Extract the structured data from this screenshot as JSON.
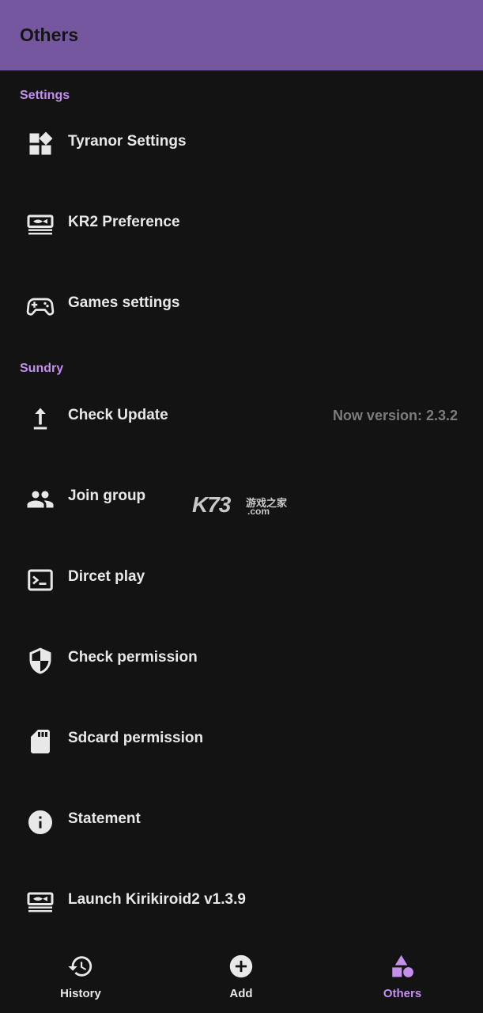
{
  "appbar": {
    "title": "Others"
  },
  "sections": {
    "settings_header": "Settings",
    "sundry_header": "Sundry"
  },
  "items": {
    "tyranor": {
      "label": "Tyranor Settings",
      "icon": "widgets-icon"
    },
    "kr2": {
      "label": "KR2 Preference",
      "icon": "kr2-logo-icon"
    },
    "games": {
      "label": "Games settings",
      "icon": "gamepad-icon"
    },
    "update": {
      "label": "Check Update",
      "trailing": "Now version: 2.3.2",
      "icon": "upload-arrow-icon"
    },
    "join": {
      "label": "Join group",
      "icon": "people-icon"
    },
    "direct": {
      "label": "Dircet play",
      "icon": "terminal-icon"
    },
    "permission": {
      "label": "Check permission",
      "icon": "shield-icon"
    },
    "sdcard": {
      "label": "Sdcard permission",
      "icon": "sdcard-icon"
    },
    "statement": {
      "label": "Statement",
      "icon": "info-icon"
    },
    "launch": {
      "label": "Launch Kirikiroid2 v1.3.9",
      "icon": "kr2-logo-icon"
    }
  },
  "watermark": {
    "brand": "K73",
    "chinese": "游戏之家",
    "domain": ".com"
  },
  "bottom_nav": {
    "history": "History",
    "add": "Add",
    "others": "Others"
  },
  "colors": {
    "appbar": "#7557a0",
    "accent": "#c390ee",
    "background": "#131313",
    "text": "#e8e8e8",
    "secondary_text": "#7c7c7c"
  }
}
